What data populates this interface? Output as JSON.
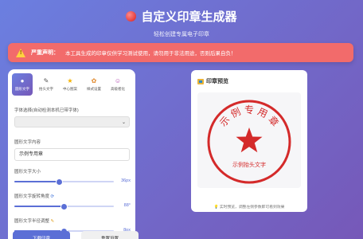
{
  "header": {
    "title": "自定义印章生成器",
    "subtitle": "轻松创建专属电子印章"
  },
  "warning": {
    "title": "严重声明：",
    "text": "本工具生成的印章仅供学习测试使用，请勿用于非法用途，否则后果自负！"
  },
  "tabs": [
    {
      "label": "圆形文字",
      "icon": "circle-icon",
      "glyph": "●",
      "color": "#3a6fd8",
      "active": true
    },
    {
      "label": "抬头文字",
      "icon": "pencil-icon",
      "glyph": "✎",
      "color": "#555555",
      "active": false
    },
    {
      "label": "中心图案",
      "icon": "star-icon",
      "glyph": "★",
      "color": "#f5b301",
      "active": false
    },
    {
      "label": "样式设置",
      "icon": "palette-icon",
      "glyph": "✿",
      "color": "#e08a2e",
      "active": false
    },
    {
      "label": "高级者化",
      "icon": "theater-mask-icon",
      "glyph": "☺",
      "color": "#b04ab0",
      "active": false
    }
  ],
  "form": {
    "font_label": "字体选择(自动检测本机已带字体)",
    "font_value": "",
    "content_label": "圆形文字内容",
    "content_value": "示例专用章",
    "size_label": "圆形文字大小",
    "size_value": "36px",
    "size_fraction": 0.45,
    "spacing_label": "圆形文字旋转角度",
    "spacing_icon": "rotate-icon",
    "spacing_value": "88°",
    "spacing_fraction": 0.5,
    "offset_label": "圆形文字半径调整",
    "offset_icon": "ruler-icon",
    "offset_value": "8px",
    "offset_fraction": 0.5
  },
  "buttons": {
    "primary": "下载印章",
    "secondary": "重置设置"
  },
  "preview": {
    "title": "印章预览",
    "title_icon": "picture-icon",
    "stamp_color": "#d42a2a",
    "circle_text": "示例专用章",
    "bottom_text": "示例抬头文字",
    "center_icon": "star-icon",
    "tip": "💡 实时预览，调整左侧参数即可看到效果"
  }
}
